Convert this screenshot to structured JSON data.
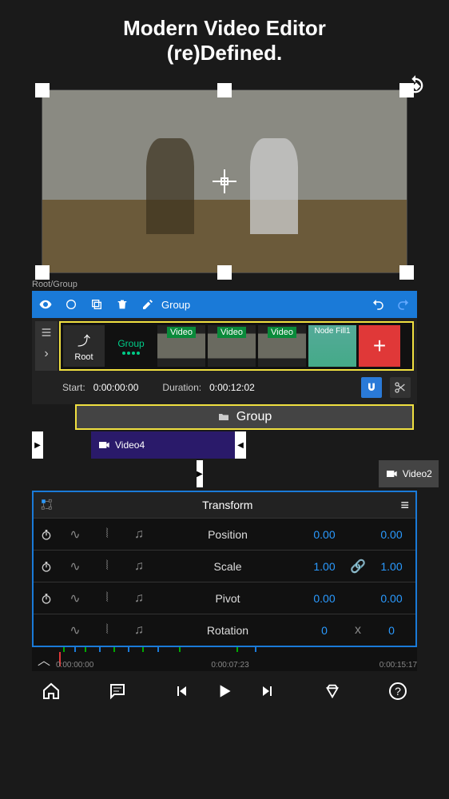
{
  "header": {
    "title": "Modern Video Editor",
    "subtitle": "(re)Defined."
  },
  "breadcrumb": "Root/Group",
  "toolbar": {
    "group_label": "Group"
  },
  "strip": {
    "root_label": "Root",
    "group_label": "Group",
    "items": [
      {
        "label": "Video"
      },
      {
        "label": "Video"
      },
      {
        "label": "Video"
      },
      {
        "label": "Node Fill1"
      }
    ]
  },
  "timing": {
    "start_label": "Start:",
    "start_value": "0:00:00:00",
    "duration_label": "Duration:",
    "duration_value": "0:00:12:02"
  },
  "tracks": {
    "group_label": "Group",
    "video4_label": "Video4",
    "video2_label": "Video2"
  },
  "transform": {
    "title": "Transform",
    "rows": [
      {
        "label": "Position",
        "a": "0.00",
        "b": "0.00",
        "link": false
      },
      {
        "label": "Scale",
        "a": "1.00",
        "b": "1.00",
        "link": true
      },
      {
        "label": "Pivot",
        "a": "0.00",
        "b": "0.00",
        "link": false
      },
      {
        "label": "Rotation",
        "a": "0",
        "mid": "x",
        "b": "0",
        "link": false
      }
    ]
  },
  "timeline": {
    "t0": "0:00:00:00",
    "t1": "0:00:07:23",
    "t2": "0:00:15:17"
  }
}
